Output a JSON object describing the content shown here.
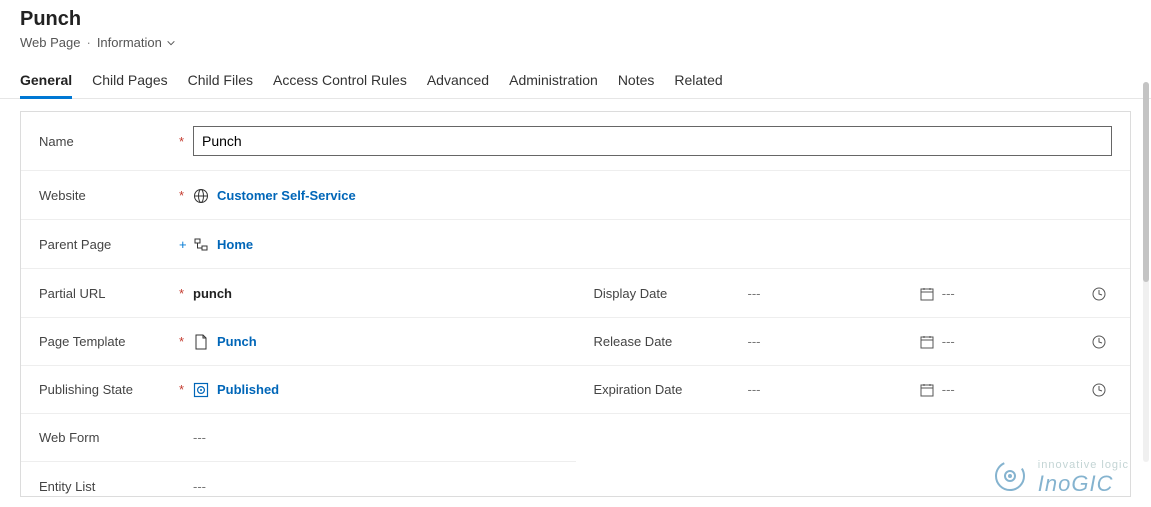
{
  "header": {
    "title": "Punch",
    "entity": "Web Page",
    "form": "Information"
  },
  "tabs": [
    {
      "label": "General",
      "active": true
    },
    {
      "label": "Child Pages",
      "active": false
    },
    {
      "label": "Child Files",
      "active": false
    },
    {
      "label": "Access Control Rules",
      "active": false
    },
    {
      "label": "Advanced",
      "active": false
    },
    {
      "label": "Administration",
      "active": false
    },
    {
      "label": "Notes",
      "active": false
    },
    {
      "label": "Related",
      "active": false
    }
  ],
  "fields": {
    "name_label": "Name",
    "name_value": "Punch",
    "website_label": "Website",
    "website_value": "Customer Self-Service",
    "parent_label": "Parent Page",
    "parent_value": "Home",
    "partial_url_label": "Partial URL",
    "partial_url_value": "punch",
    "page_template_label": "Page Template",
    "page_template_value": "Punch",
    "publishing_state_label": "Publishing State",
    "publishing_state_value": "Published",
    "webform_label": "Web Form",
    "webform_value": "---",
    "entitylist_label": "Entity List",
    "entitylist_value": "---",
    "display_date_label": "Display Date",
    "release_date_label": "Release Date",
    "expiration_date_label": "Expiration Date",
    "date_empty": "---",
    "time_empty": "---"
  },
  "watermark": {
    "line1": "innovative logic",
    "line2": "InoGIC"
  }
}
